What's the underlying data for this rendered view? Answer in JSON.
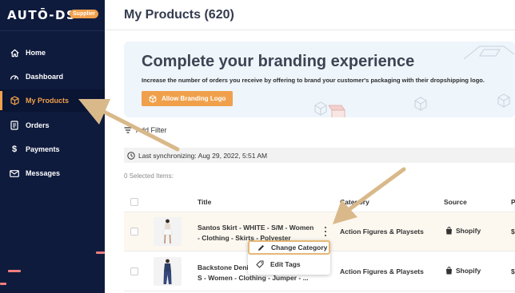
{
  "app": {
    "logo_text": "AUTŌ-DS-",
    "badge": "Supplier"
  },
  "sidebar": {
    "items": [
      {
        "label": "Home",
        "icon": "home-icon"
      },
      {
        "label": "Dashboard",
        "icon": "dashboard-icon"
      },
      {
        "label": "My Products",
        "icon": "box-icon",
        "active": true
      },
      {
        "label": "Orders",
        "icon": "orders-icon"
      },
      {
        "label": "Payments",
        "icon": "dollar-icon"
      },
      {
        "label": "Messages",
        "icon": "mail-icon"
      }
    ]
  },
  "header": {
    "title": "My Products (620)"
  },
  "banner": {
    "title": "Complete your branding experience",
    "subtitle": "Increase the number of orders you receive by offering to brand your customer's packaging with their dropshipping logo.",
    "button_label": "Allow Branding Logo"
  },
  "toolbar": {
    "filter_label": "Add Filter",
    "sync_text": "Last synchronizing: Aug 29, 2022, 5:51 AM",
    "selected_text": "0 Selected Items:"
  },
  "table": {
    "columns": [
      "Title",
      "Category",
      "Source",
      "P"
    ],
    "rows": [
      {
        "title": "Santos Skirt - WHITE - S/M - Women - Clothing - Skirts - Polyester",
        "category": "Action Figures & Playsets",
        "source": "Shopify",
        "price": "$"
      },
      {
        "title": "Backstone Denim Jumpsuit - NAVY - S - Women - Clothing - Jumper - ...",
        "category": "Action Figures & Playsets",
        "source": "Shopify",
        "price": "$"
      }
    ]
  },
  "context_menu": {
    "items": [
      {
        "label": "Change Category",
        "icon": "pencil-icon"
      },
      {
        "label": "Edit Tags",
        "icon": "tag-icon"
      }
    ]
  },
  "colors": {
    "sidebar_bg": "#0f1b3d",
    "accent": "#f0a04b",
    "banner_bg": "#eef5fb",
    "annotation_arrow": "#d9b98a"
  }
}
